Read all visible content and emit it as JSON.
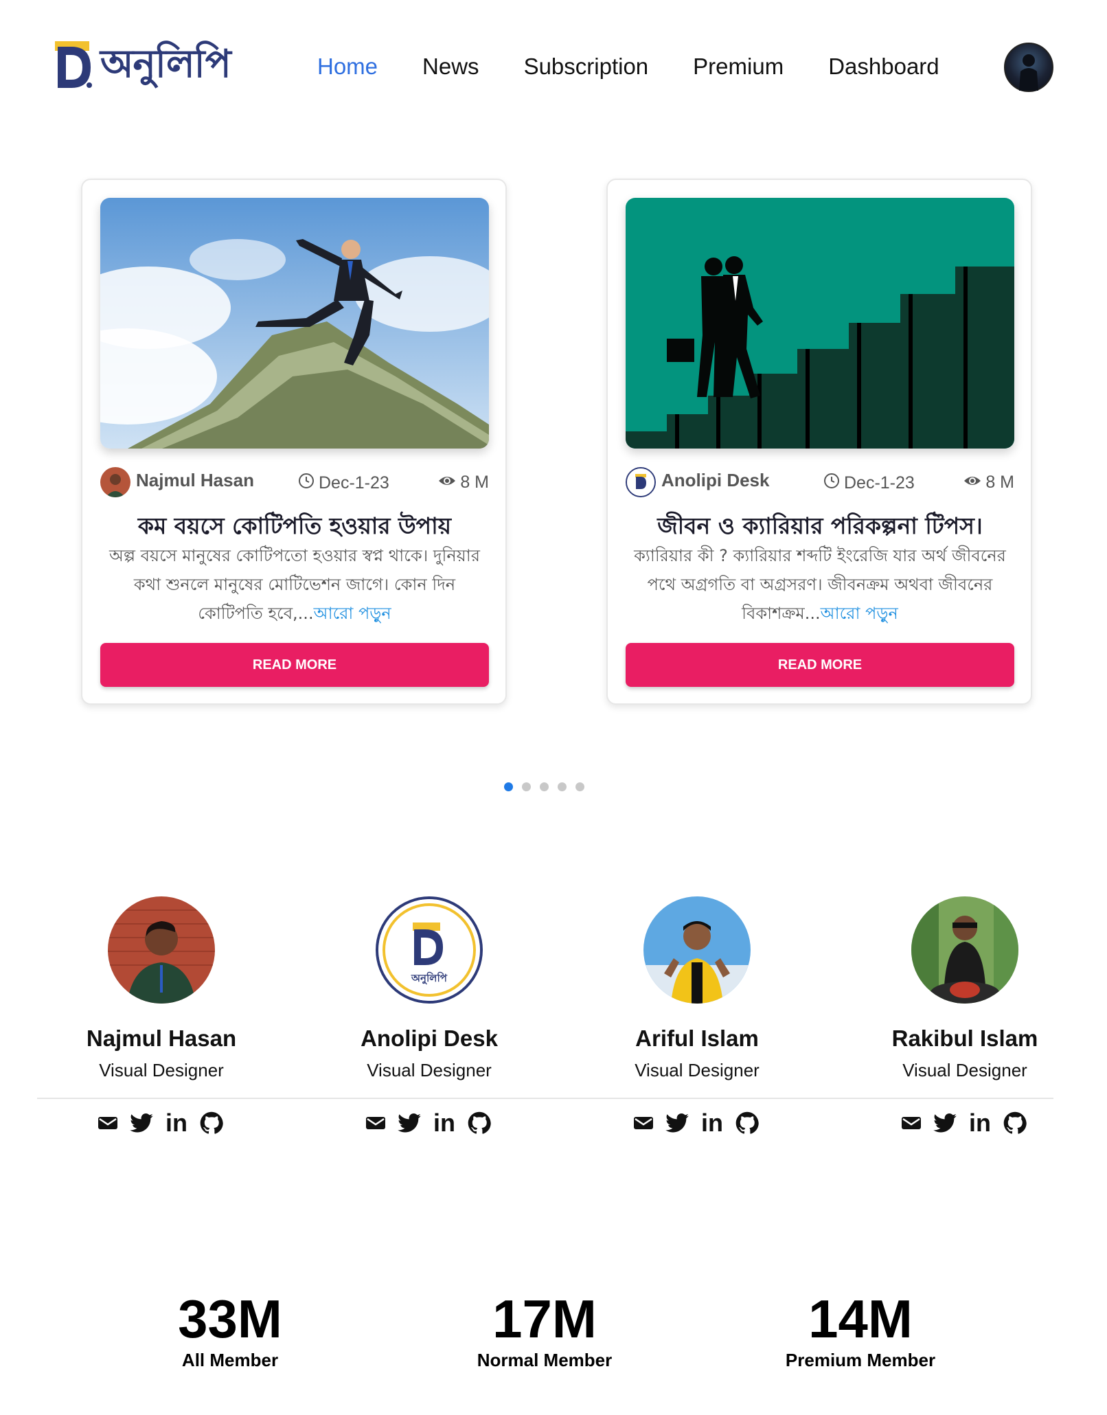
{
  "brand": {
    "logo_text": "অনুলিপি",
    "colors": {
      "navy": "#2d3a78",
      "yellow": "#f2c12e",
      "accent": "#e91e63",
      "link": "#1e8fe0",
      "active_nav": "#2f6fe0"
    }
  },
  "nav": {
    "items": [
      {
        "label": "Home",
        "active": true
      },
      {
        "label": "News",
        "active": false
      },
      {
        "label": "Subscription",
        "active": false
      },
      {
        "label": "Premium",
        "active": false
      },
      {
        "label": "Dashboard",
        "active": false
      }
    ],
    "profile_icon": "user-avatar"
  },
  "carousel": {
    "cards": [
      {
        "image_icon": "businessman-jumping-money-image",
        "author": "Najmul Hasan",
        "date": "Dec-1-23",
        "views": "8 M",
        "title": "কম বয়সে কোটিপতি হওয়ার উপায়",
        "description": "অল্প বয়সে মানুষের কোটিপতো হওয়ার স্বপ্ন থাকে। দুনিয়ার কথা শুনলে মানুষের মোটিভেশন জাগে। কোন দিন কোটিপতি হবে,...",
        "read_more_link": "আরো পড়ুন",
        "button": "READ MORE"
      },
      {
        "image_icon": "business-people-climbing-stairs-image",
        "author": "Anolipi Desk",
        "date": "Dec-1-23",
        "views": "8 M",
        "title": "জীবন ও ক্যারিয়ার পরিকল্পনা টিপস।",
        "description": "ক্যারিয়ার কী ? ক্যারিয়ার শব্দটি ইংরেজি যার অর্থ জীবনের পথে অগ্রগতি বা অগ্রসরণ। জীবনক্রম অথবা জীবনের বিকাশক্রম...",
        "read_more_link": "আরো পড়ুন",
        "button": "READ MORE"
      }
    ],
    "dots_count": 5,
    "active_dot": 0
  },
  "team": {
    "members": [
      {
        "name": "Najmul Hasan",
        "role": "Visual Designer"
      },
      {
        "name": "Anolipi Desk",
        "role": "Visual Designer",
        "logo_text": "অনুলিপি"
      },
      {
        "name": "Ariful Islam",
        "role": "Visual Designer"
      },
      {
        "name": "Rakibul Islam",
        "role": "Visual Designer"
      }
    ],
    "social_icons": [
      "mail-icon",
      "twitter-icon",
      "linkedin-icon",
      "github-icon"
    ],
    "linkedin_text": "in"
  },
  "stats": [
    {
      "value": "33M",
      "label": "All Member"
    },
    {
      "value": "17M",
      "label": "Normal Member"
    },
    {
      "value": "14M",
      "label": "Premium Member"
    }
  ]
}
